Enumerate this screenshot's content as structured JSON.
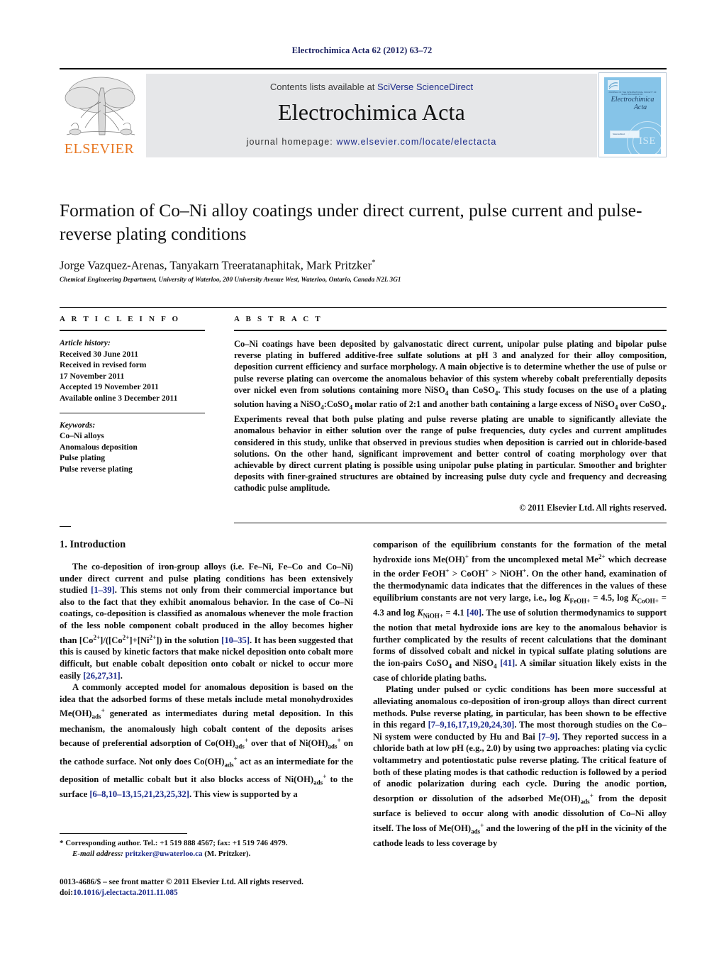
{
  "running_head": "Electrochimica Acta 62 (2012) 63–72",
  "masthead": {
    "publisher_name": "ELSEVIER",
    "contents_prefix": "Contents lists available at ",
    "contents_link": "SciVerse ScienceDirect",
    "journal_name": "Electrochimica Acta",
    "homepage_prefix": "journal homepage: ",
    "homepage_url": "www.elsevier.com/locate/electacta",
    "cover": {
      "society_line": "JOURNAL OF THE INTERNATIONAL SOCIETY OF ELECTROCHEMISTRY",
      "title_line1": "Electrochimica",
      "title_line2": "Acta",
      "badge": "ScienceDirect",
      "seal": "ISE"
    },
    "link_color": "#1b2a8a",
    "elsevier_orange": "#E87722"
  },
  "article": {
    "title": "Formation of Co–Ni alloy coatings under direct current, pulse current and pulse-reverse plating conditions",
    "authors": "Jorge Vazquez-Arenas, Tanyakarn Treeratanaphitak, Mark Pritzker",
    "corresponding_marker": "*",
    "affiliation": "Chemical Engineering Department, University of Waterloo, 200 University Avenue West, Waterloo, Ontario, Canada N2L 3G1"
  },
  "article_info": {
    "heading": "A R T I C L E   I N F O",
    "history_label": "Article history:",
    "history": [
      "Received 30 June 2011",
      "Received in revised form",
      "17 November 2011",
      "Accepted 19 November 2011",
      "Available online 3 December 2011"
    ],
    "keywords_label": "Keywords:",
    "keywords": [
      "Co–Ni alloys",
      "Anomalous deposition",
      "Pulse plating",
      "Pulse reverse plating"
    ]
  },
  "abstract": {
    "heading": "A B S T R A C T",
    "copyright": "© 2011 Elsevier Ltd. All rights reserved."
  },
  "intro": {
    "heading": "1.  Introduction"
  },
  "footnote": {
    "corresponding": "* Corresponding author. Tel.: +1 519 888 4567; fax: +1 519 746 4979.",
    "email_label": "E-mail address:",
    "email": "pritzker@uwaterloo.ca",
    "email_suffix": "(M. Pritzker).",
    "issn_line": "0013-4686/$ – see front matter © 2011 Elsevier Ltd. All rights reserved.",
    "doi_prefix": "doi:",
    "doi": "10.1016/j.electacta.2011.11.085"
  }
}
